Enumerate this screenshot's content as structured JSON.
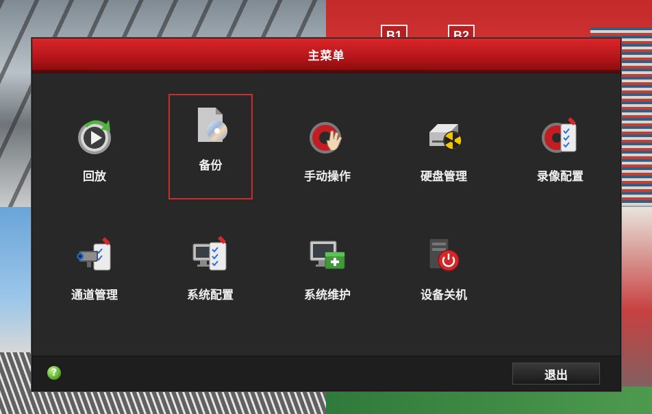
{
  "dialog": {
    "title": "主菜单"
  },
  "background": {
    "tiles": [
      "B1",
      "B2"
    ]
  },
  "menu": {
    "selected": "备份",
    "items": [
      {
        "label": "回放",
        "icon": "playback-icon"
      },
      {
        "label": "备份",
        "icon": "backup-disc-icon"
      },
      {
        "label": "手动操作",
        "icon": "manual-operation-icon"
      },
      {
        "label": "硬盘管理",
        "icon": "hdd-management-icon"
      },
      {
        "label": "录像配置",
        "icon": "record-config-icon"
      },
      {
        "label": "通道管理",
        "icon": "camera-channel-icon"
      },
      {
        "label": "系统配置",
        "icon": "system-config-icon"
      },
      {
        "label": "系统维护",
        "icon": "system-maintenance-icon"
      },
      {
        "label": "设备关机",
        "icon": "power-off-icon"
      }
    ]
  },
  "footer": {
    "help_label": "?",
    "exit_label": "退出"
  },
  "colors": {
    "title_bar": "#c41f23",
    "selection_border": "#d6292c",
    "panel_background": "#282828"
  }
}
